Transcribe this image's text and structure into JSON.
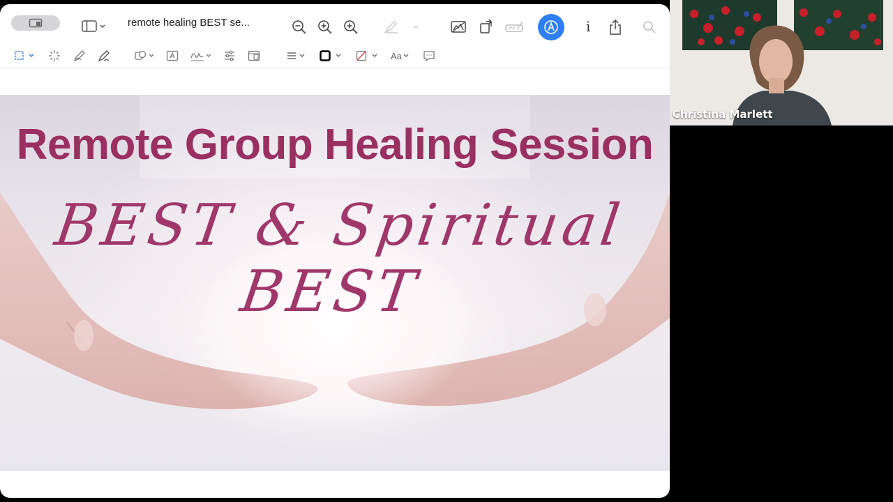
{
  "window": {
    "document_title": "remote healing BEST se...",
    "toolbar_icons": [
      "sidebar-toggle-icon",
      "zoom-out-icon",
      "zoom-in-icon",
      "zoom-fit-icon",
      "highlight-pen-icon",
      "crop-icon",
      "rotate-icon",
      "signature-icon",
      "markup-icon",
      "info-icon",
      "share-icon",
      "search-icon"
    ],
    "markup_tools": {
      "text_style_label": "Aa"
    }
  },
  "slide": {
    "title": "Remote Group Healing Session",
    "subtitle": "BEST & Spiritual BEST",
    "title_color": "#9a2f62"
  },
  "video": {
    "participant_name": "Christina Marlett"
  },
  "colors": {
    "accent": "#2f7ef6",
    "title_magenta": "#9a2f62"
  }
}
